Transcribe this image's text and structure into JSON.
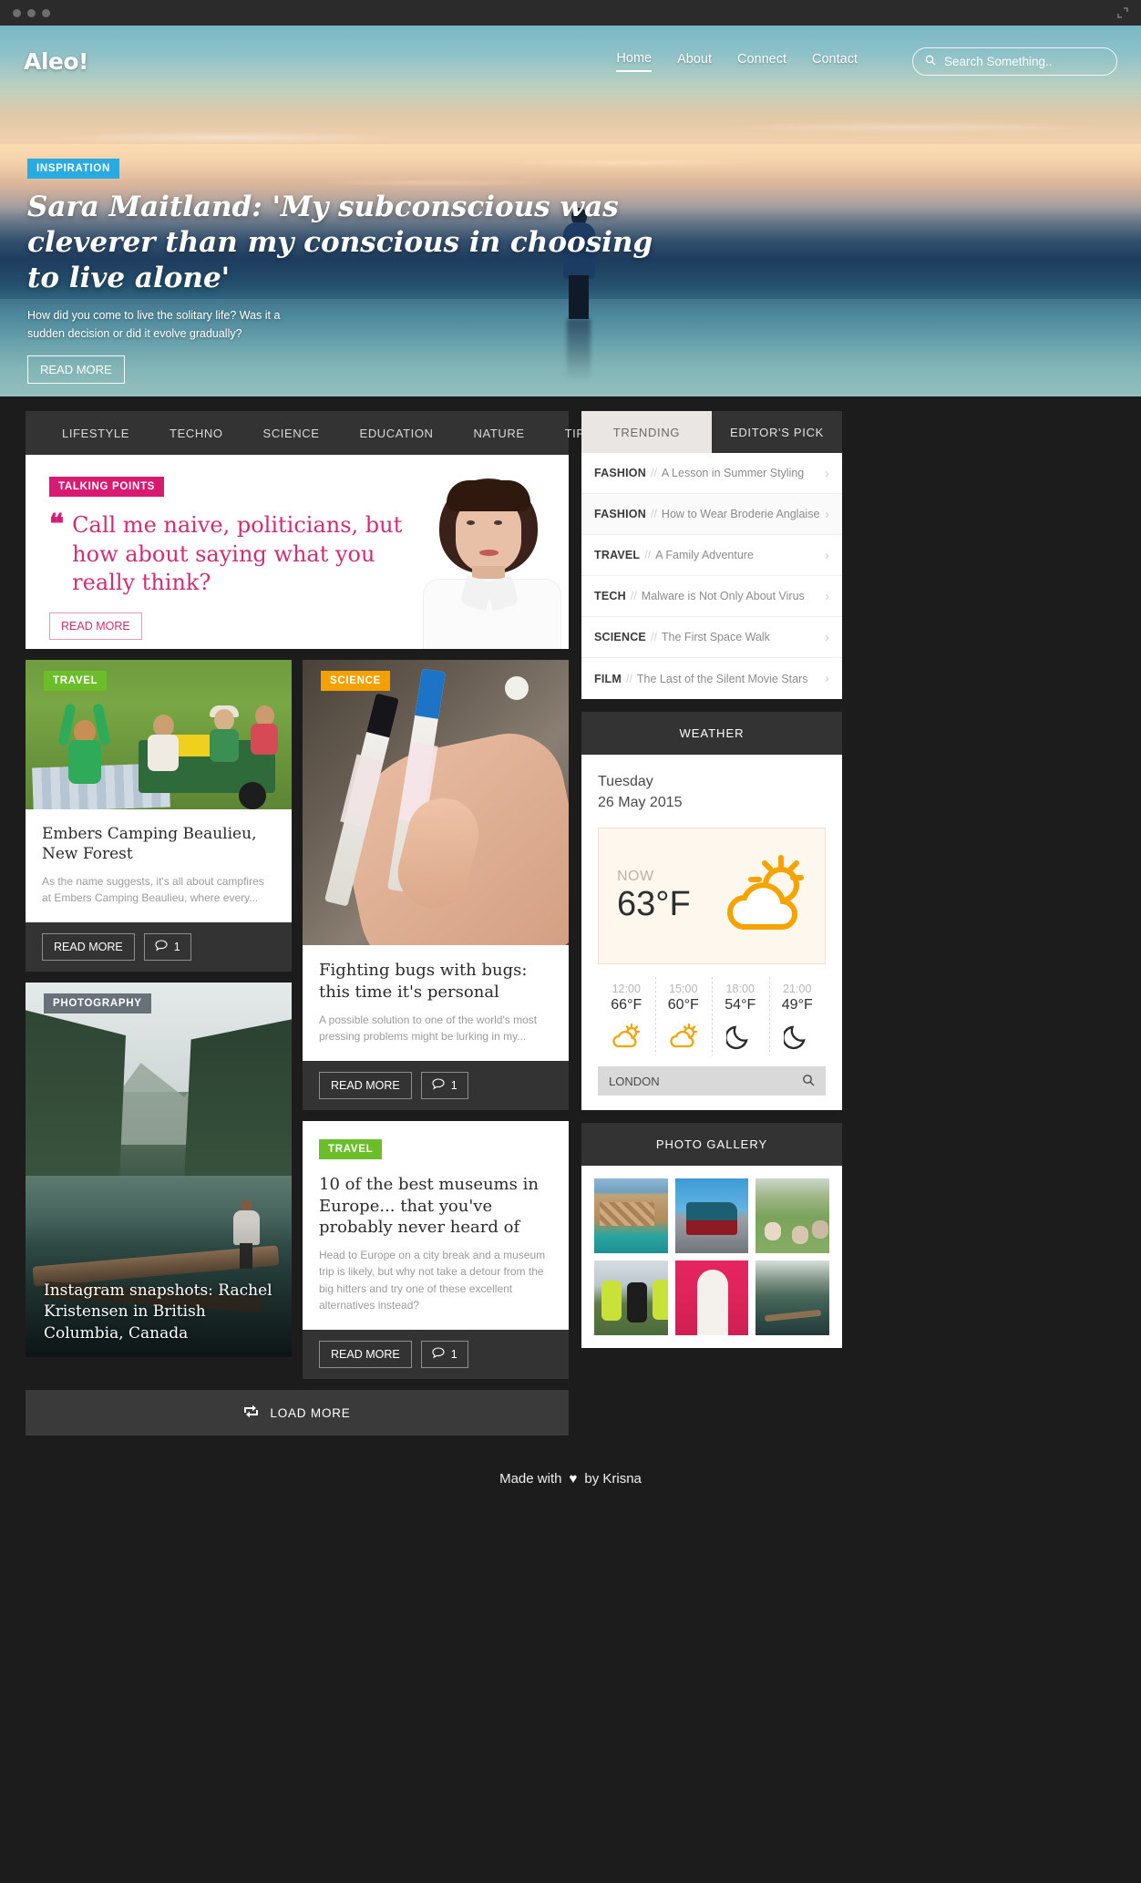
{
  "window": {
    "dots": 3,
    "expand_icon": "expand-icon"
  },
  "header": {
    "logo": "Aleo!",
    "nav": [
      {
        "label": "Home",
        "active": true
      },
      {
        "label": "About",
        "active": false
      },
      {
        "label": "Connect",
        "active": false
      },
      {
        "label": "Contact",
        "active": false
      }
    ],
    "search_placeholder": "Search Something.."
  },
  "hero": {
    "badge": "INSPIRATION",
    "badge_color": "#29abe2",
    "title": "Sara Maitland: 'My subconscious was cleverer than my conscious in choosing to live alone'",
    "subtitle": "How did you come to live the solitary life? Was it a sudden decision or did it evolve gradually?",
    "cta": "READ MORE"
  },
  "categories": [
    "LIFESTYLE",
    "TECHNO",
    "SCIENCE",
    "EDUCATION",
    "NATURE",
    "TIPS"
  ],
  "more_icon": "ellipsis-icon",
  "talking_points": {
    "badge": "TALKING POINTS",
    "badge_color": "#d91a72",
    "quote_mark": "“",
    "quote": "Call me naive, politicians, but how about saying what you really think?",
    "cta": "READ MORE"
  },
  "articles": [
    {
      "tag": "TRAVEL",
      "tag_color": "#6cbd2a",
      "title": "Embers Camping Beaulieu, New Forest",
      "desc": "As the name suggests, it's all about campfires at Embers Camping Beaulieu, where every...",
      "cta": "READ MORE",
      "comments": "1"
    },
    {
      "tag": "PHOTOGRAPHY",
      "tag_color": "#46505a",
      "title": "Instagram snapshots: Rachel Kristensen in British Columbia, Canada"
    },
    {
      "tag": "SCIENCE",
      "tag_color": "#f2a100",
      "title": "Fighting bugs with bugs: this time it's personal",
      "desc": "A possible solution to one of the world's most pressing problems might be lurking in my...",
      "cta": "READ MORE",
      "comments": "1"
    },
    {
      "tag": "TRAVEL",
      "tag_color": "#6cbd2a",
      "title": "10 of the best museums in Europe... that you've probably never heard of",
      "desc": "Head to Europe on a city break and a museum trip is likely, but why not take a detour from the big hitters and try one of these excellent alternatives instead?",
      "cta": "READ MORE",
      "comments": "1"
    }
  ],
  "load_more": {
    "label": "LOAD MORE",
    "icon": "refresh-icon"
  },
  "sidebar": {
    "tabs": [
      {
        "label": "TRENDING",
        "active": true
      },
      {
        "label": "EDITOR'S PICK",
        "active": false
      }
    ],
    "trending": [
      {
        "cat": "FASHION",
        "sep": "//",
        "title": "A Lesson in Summer Styling"
      },
      {
        "cat": "FASHION",
        "sep": "//",
        "title": "How to Wear Broderie Anglaise"
      },
      {
        "cat": "TRAVEL",
        "sep": "//",
        "title": "A Family Adventure"
      },
      {
        "cat": "TECH",
        "sep": "//",
        "title": "Malware is Not Only About Virus"
      },
      {
        "cat": "SCIENCE",
        "sep": "//",
        "title": "The First Space Walk"
      },
      {
        "cat": "FILM",
        "sep": "//",
        "title": "The Last of the Silent Movie Stars"
      }
    ],
    "weather": {
      "title": "WEATHER",
      "day": "Tuesday",
      "date": "26 May 2015",
      "now_label": "NOW",
      "now_temp": "63°F",
      "now_icon": "sun-cloud-icon",
      "accent_color": "#f2a100",
      "hours": [
        {
          "time": "12:00",
          "temp": "66°F",
          "icon": "sun-cloud-icon"
        },
        {
          "time": "15:00",
          "temp": "60°F",
          "icon": "sun-cloud-icon"
        },
        {
          "time": "18:00",
          "temp": "54°F",
          "icon": "moon-icon"
        },
        {
          "time": "21:00",
          "temp": "49°F",
          "icon": "moon-icon"
        }
      ],
      "city": "LONDON",
      "city_search_icon": "search-icon"
    },
    "gallery": {
      "title": "PHOTO GALLERY",
      "count": 6
    }
  },
  "footer": {
    "prefix": "Made with",
    "heart": "♥",
    "suffix": "by Krisna"
  }
}
